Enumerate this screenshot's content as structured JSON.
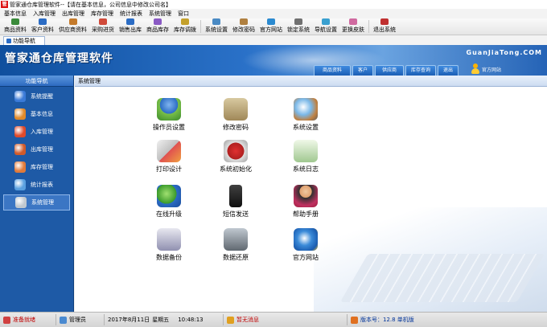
{
  "window": {
    "title": "管家通仓库管理软件--【请在基本信息，公司信息中修改公司名】"
  },
  "menu": [
    "基本信息",
    "入库管理",
    "出库管理",
    "库存管理",
    "统计报表",
    "系统管理",
    "窗口"
  ],
  "toolbar": [
    {
      "label": "商品资料",
      "color": "#3a8a3a"
    },
    {
      "label": "客户资料",
      "color": "#2b6cc4"
    },
    {
      "label": "供应商资料",
      "color": "#c47a2b"
    },
    {
      "label": "采购进货",
      "color": "#d04a3a"
    },
    {
      "label": "销售出库",
      "color": "#2b6cc4"
    },
    {
      "label": "商品库存",
      "color": "#8a5ac4"
    },
    {
      "label": "库存调拨",
      "color": "#c4a02b"
    },
    {
      "label": "系统设置",
      "color": "#4a8ac4"
    },
    {
      "label": "修改密码",
      "color": "#b08040"
    },
    {
      "label": "官方网站",
      "color": "#2b8ad0"
    },
    {
      "label": "锁定系统",
      "color": "#707070"
    },
    {
      "label": "导航设置",
      "color": "#3aa0d0"
    },
    {
      "label": "更换皮肤",
      "color": "#d06aa0"
    },
    {
      "label": "退出系统",
      "color": "#c03030"
    }
  ],
  "nav_tab": "功能导航",
  "banner": {
    "brand": "管家通仓库管理软件",
    "site": "GuanJiaTong.COM",
    "tabs": [
      "商品资料",
      "客户",
      "供应商",
      "库存查询",
      "退出"
    ],
    "official": "官方网站"
  },
  "sidebar": {
    "header": "功能导航",
    "items": [
      {
        "label": "系统提醒",
        "color": "#3a7ad8",
        "active": false
      },
      {
        "label": "基本信息",
        "color": "#e08a2a",
        "active": false
      },
      {
        "label": "入库管理",
        "color": "#e04a2a",
        "active": false
      },
      {
        "label": "出库管理",
        "color": "#d05a2a",
        "active": false
      },
      {
        "label": "库存管理",
        "color": "#e07a3a",
        "active": false
      },
      {
        "label": "统计报表",
        "color": "#5aa0e0",
        "active": false
      },
      {
        "label": "系统管理",
        "color": "#c0c8d0",
        "active": true
      }
    ]
  },
  "content": {
    "header": "系统管理",
    "functions": [
      {
        "label": "操作员设置",
        "icon": "operator-icon"
      },
      {
        "label": "修改密码",
        "icon": "password-icon"
      },
      {
        "label": "系统设置",
        "icon": "settings-icon"
      },
      {
        "label": "打印设计",
        "icon": "printer-icon"
      },
      {
        "label": "系统初始化",
        "icon": "init-icon"
      },
      {
        "label": "系统日志",
        "icon": "log-icon"
      },
      {
        "label": "在线升级",
        "icon": "upgrade-icon"
      },
      {
        "label": "短信发送",
        "icon": "phone-icon"
      },
      {
        "label": "帮助手册",
        "icon": "help-icon"
      },
      {
        "label": "数据备份",
        "icon": "backup-icon"
      },
      {
        "label": "数据还原",
        "icon": "restore-icon"
      },
      {
        "label": "官方网站",
        "icon": "ie-icon"
      }
    ]
  },
  "status": {
    "db": "准备就绪",
    "user": "管理员",
    "date": "2017年8月11日",
    "weekday": "星期五",
    "time": "10:48:13",
    "message": "暂无消息",
    "version": "版本号：12.8 单机版"
  }
}
